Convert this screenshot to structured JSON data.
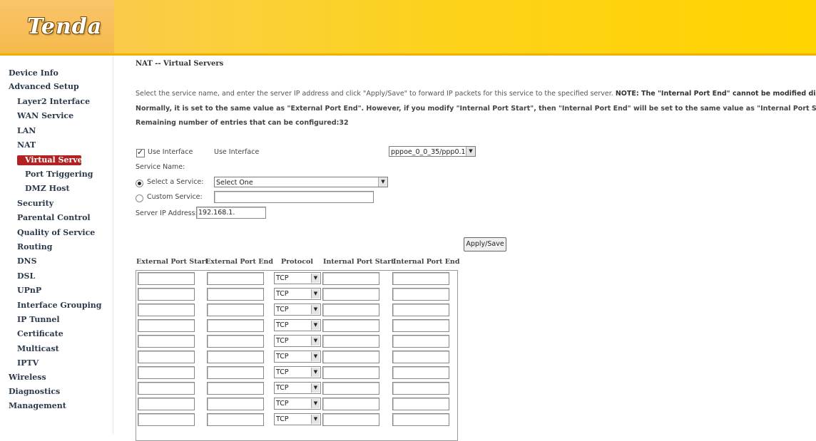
{
  "brand": {
    "logo_text": "Tenda"
  },
  "sidebar": {
    "items": [
      {
        "label": "Device Info"
      },
      {
        "label": "Advanced Setup"
      },
      {
        "label": "Layer2 Interface"
      },
      {
        "label": "WAN Service"
      },
      {
        "label": "LAN"
      },
      {
        "label": "NAT"
      },
      {
        "label": "Virtual Servers"
      },
      {
        "label": "Port Triggering"
      },
      {
        "label": "DMZ Host"
      },
      {
        "label": "Security"
      },
      {
        "label": "Parental Control"
      },
      {
        "label": "Quality of Service"
      },
      {
        "label": "Routing"
      },
      {
        "label": "DNS"
      },
      {
        "label": "DSL"
      },
      {
        "label": "UPnP"
      },
      {
        "label": "Interface Grouping"
      },
      {
        "label": "IP Tunnel"
      },
      {
        "label": "Certificate"
      },
      {
        "label": "Multicast"
      },
      {
        "label": "IPTV"
      },
      {
        "label": "Wireless"
      },
      {
        "label": "Diagnostics"
      },
      {
        "label": "Management"
      }
    ],
    "active_color": "#b32222"
  },
  "main": {
    "title": "NAT -- Virtual Servers",
    "instructions_1": "Select the service name, and enter the server IP address and click \"Apply/Save\" to forward IP packets for this service to the specified server.",
    "note_1": "NOTE: The \"Internal Port End\" cannot be modified directl",
    "instructions_2": "Normally, it is set to the same value as \"External Port End\". However, if you modify \"Internal Port Start\", then \"Internal Port End\" will be set to the same value as \"Internal Port Start\"",
    "remaining": "Remaining number of entries that can be configured:32",
    "use_interface_checkbox_label": "Use Interface",
    "use_interface_label": "Use Interface",
    "interface_value": "pppoe_0_0_35/ppp0.1",
    "service_name_label": "Service Name:",
    "select_service_label": "Select a Service:",
    "select_service_value": "Select One",
    "custom_service_label": "Custom Service:",
    "custom_service_value": "",
    "server_ip_label": "Server IP Address:",
    "server_ip_value": "192.168.1.",
    "apply_button": "Apply/Save"
  },
  "table": {
    "headers": [
      "External Port Start",
      "External Port End",
      "Protocol",
      "Internal Port Start",
      "Internal Port End"
    ],
    "rows": [
      {
        "protocol": "TCP"
      },
      {
        "protocol": "TCP"
      },
      {
        "protocol": "TCP"
      },
      {
        "protocol": "TCP"
      },
      {
        "protocol": "TCP"
      },
      {
        "protocol": "TCP"
      },
      {
        "protocol": "TCP"
      },
      {
        "protocol": "TCP"
      },
      {
        "protocol": "TCP"
      },
      {
        "protocol": "TCP"
      }
    ]
  },
  "colors": {
    "header_yellow": "#ffd400",
    "header_orange": "#f7c25a",
    "active_nav": "#b32222"
  }
}
